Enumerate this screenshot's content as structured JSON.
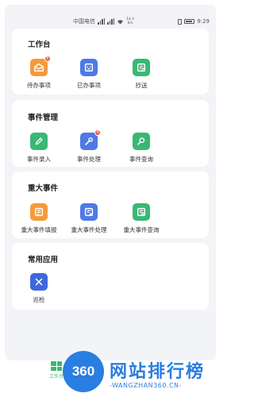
{
  "status_bar": {
    "carrier": "中国电信",
    "net_speed_value": "14.4",
    "net_speed_unit": "K/s",
    "time": "9:29"
  },
  "sections": [
    {
      "title": "工作台",
      "items": [
        {
          "label": "待办事项",
          "icon": "mail-open-icon",
          "color": "#f59a3c",
          "badge": "6"
        },
        {
          "label": "已办事项",
          "icon": "message-icon",
          "color": "#4e79e6"
        },
        {
          "label": "抄送",
          "icon": "edit-document-icon",
          "color": "#39b874"
        }
      ]
    },
    {
      "title": "事件管理",
      "items": [
        {
          "label": "事件录入",
          "icon": "pencil-icon",
          "color": "#39b874"
        },
        {
          "label": "事件处理",
          "icon": "wrench-icon",
          "color": "#4e79e6",
          "badge": "4"
        },
        {
          "label": "事件查询",
          "icon": "search-icon",
          "color": "#39b874"
        }
      ]
    },
    {
      "title": "重大事件",
      "items": [
        {
          "label": "重大事件填报",
          "icon": "form-edit-icon",
          "color": "#f59a3c"
        },
        {
          "label": "重大事件处理",
          "icon": "form-process-icon",
          "color": "#4e79e6"
        },
        {
          "label": "重大事件查询",
          "icon": "form-search-icon",
          "color": "#39b874"
        }
      ]
    },
    {
      "title": "常用应用",
      "items": [
        {
          "label": "巡检",
          "icon": "tools-icon",
          "color": "#3d69dd"
        }
      ]
    }
  ],
  "bottom_nav": {
    "tab_label": "工作台"
  },
  "watermark": {
    "logo_text": "360",
    "title": "网站排行榜",
    "subtitle": "-WANGZHAN360.CN-"
  }
}
